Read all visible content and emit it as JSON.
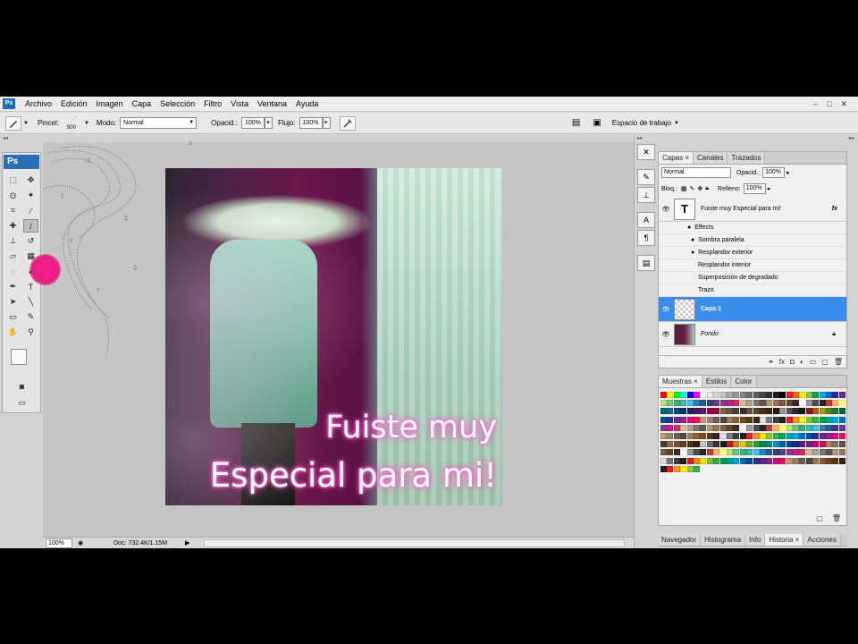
{
  "menu": {
    "items": [
      "Archivo",
      "Edición",
      "Imagen",
      "Capa",
      "Selección",
      "Filtro",
      "Vista",
      "Ventana",
      "Ayuda"
    ],
    "window_controls": [
      "–",
      "□",
      "✕"
    ]
  },
  "options": {
    "pincel_label": "Pincel:",
    "brush_size": "500",
    "modo_label": "Modo:",
    "modo_value": "Normal",
    "opacidad_label": "Opacid.:",
    "opacidad_value": "100%",
    "flujo_label": "Flujo:",
    "flujo_value": "100%",
    "workspace_label": "Espacio de trabajo"
  },
  "toolbox": {
    "logo": "Ps",
    "tools": [
      {
        "name": "marquee-tool-icon",
        "glyph": "⬚"
      },
      {
        "name": "move-tool-icon",
        "glyph": "✥"
      },
      {
        "name": "lasso-tool-icon",
        "glyph": "ʘ"
      },
      {
        "name": "magic-wand-icon",
        "glyph": "✦"
      },
      {
        "name": "crop-tool-icon",
        "glyph": "⌗"
      },
      {
        "name": "eyedropper-tool-icon",
        "glyph": "⁄"
      },
      {
        "name": "healing-brush-icon",
        "glyph": "✚"
      },
      {
        "name": "brush-tool-icon",
        "glyph": "/"
      },
      {
        "name": "clone-stamp-icon",
        "glyph": "⊥"
      },
      {
        "name": "history-brush-icon",
        "glyph": "↺"
      },
      {
        "name": "eraser-tool-icon",
        "glyph": "▱"
      },
      {
        "name": "gradient-tool-icon",
        "glyph": "▦"
      },
      {
        "name": "blur-tool-icon",
        "glyph": "◌"
      },
      {
        "name": "dodge-tool-icon",
        "glyph": "●"
      },
      {
        "name": "pen-tool-icon",
        "glyph": "✒"
      },
      {
        "name": "type-tool-icon",
        "glyph": "T"
      },
      {
        "name": "path-selection-icon",
        "glyph": "➤"
      },
      {
        "name": "shape-tool-icon",
        "glyph": "╲"
      },
      {
        "name": "notes-tool-icon",
        "glyph": "▭"
      },
      {
        "name": "3d-tool-icon",
        "glyph": "✎"
      },
      {
        "name": "hand-tool-icon",
        "glyph": "✋"
      },
      {
        "name": "zoom-tool-icon",
        "glyph": "⚲"
      }
    ]
  },
  "canvas": {
    "caption_line1": "Fuiste muy",
    "caption_line2": "Especial para mi!"
  },
  "status": {
    "zoom": "100%",
    "doc_info": "Doc: 732.4K/1.15M"
  },
  "layers_panel": {
    "tabs": [
      "Capas",
      "Canales",
      "Trazados"
    ],
    "blend_mode": "Normal",
    "opacidad_label": "Opacid.:",
    "opacidad_value": "100%",
    "bloq_label": "Bloq.:",
    "relleno_label": "Relleno:",
    "relleno_value": "100%",
    "text_layer_name": "Fuiste muy Especial para mi!",
    "fx_label": "fx",
    "effects_label": "Effects",
    "effects": [
      "Sombra paralela",
      "Resplandor exterior",
      "Resplandor interior",
      "Superposición de degradado",
      "Trazo"
    ],
    "layer1_name": "Capa 1",
    "background_name": "Fondo"
  },
  "swatches_panel": {
    "tabs": [
      "Muestras",
      "Estilos",
      "Color"
    ]
  },
  "bottom_tabs": [
    "Navegador",
    "Histograma",
    "Info",
    "Historia",
    "Acciones"
  ],
  "colors": {
    "selected_layer": "#3a8dea",
    "cursor_pink": "#f01e86",
    "text_glow": "#ff3fbf"
  }
}
